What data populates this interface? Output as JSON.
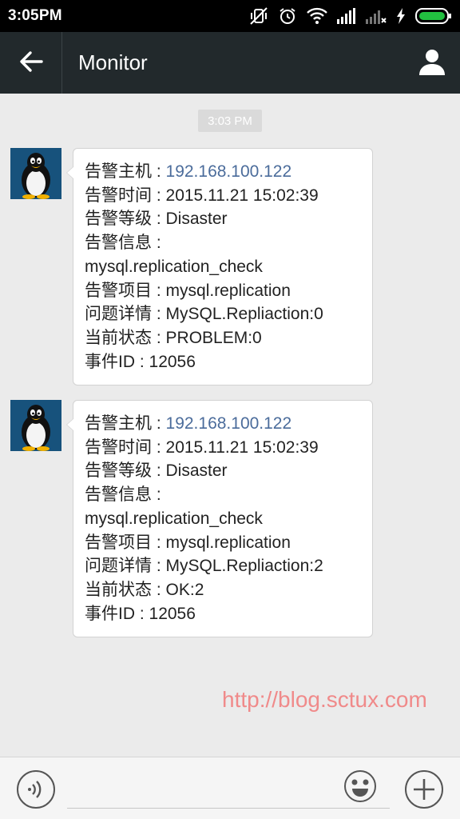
{
  "status_bar": {
    "time": "3:05PM",
    "icons": [
      "mute-vibrate-icon",
      "alarm-icon",
      "wifi-icon",
      "signal-icon",
      "signal-no-service-icon",
      "charging-icon",
      "battery-icon"
    ]
  },
  "header": {
    "title": "Monitor",
    "back_icon": "back-arrow-icon",
    "profile_icon": "person-icon"
  },
  "chat": {
    "timestamp": "3:03 PM",
    "messages": [
      {
        "avatar": "tux-penguin-avatar",
        "lines": [
          {
            "label": "告警主机 : ",
            "value": "192.168.100.122",
            "is_link": true
          },
          {
            "label": "告警时间 : ",
            "value": "2015.11.21 15:02:39"
          },
          {
            "label": "告警等级 : ",
            "value": "Disaster"
          },
          {
            "label": "告警信息 : ",
            "value": ""
          },
          {
            "label": "",
            "value": "mysql.replication_check"
          },
          {
            "label": "告警项目 : ",
            "value": "mysql.replication"
          },
          {
            "label": "问题详情 : ",
            "value": "MySQL.Repliaction:0"
          },
          {
            "label": "当前状态 : ",
            "value": "PROBLEM:0"
          },
          {
            "label": "事件ID ",
            "value": " : 12056"
          }
        ]
      },
      {
        "avatar": "tux-penguin-avatar",
        "lines": [
          {
            "label": "告警主机 : ",
            "value": "192.168.100.122",
            "is_link": true
          },
          {
            "label": "告警时间 : ",
            "value": "2015.11.21 15:02:39"
          },
          {
            "label": "告警等级 : ",
            "value": "Disaster"
          },
          {
            "label": "告警信息 : ",
            "value": ""
          },
          {
            "label": "",
            "value": "mysql.replication_check"
          },
          {
            "label": "告警项目 : ",
            "value": "mysql.replication"
          },
          {
            "label": "问题详情 : ",
            "value": "MySQL.Repliaction:2"
          },
          {
            "label": "当前状态 : ",
            "value": "OK:2"
          },
          {
            "label": "事件ID ",
            "value": " : 12056"
          }
        ]
      }
    ]
  },
  "watermark": "http://blog.sctux.com",
  "input_bar": {
    "voice_icon": "voice-input-icon",
    "text_value": "",
    "emoji_icon": "emoji-icon",
    "plus_icon": "plus-icon"
  },
  "colors": {
    "header_bg": "#22292c",
    "chat_bg": "#ebebeb",
    "link": "#4b6c9b",
    "watermark": "#f08a8a"
  }
}
